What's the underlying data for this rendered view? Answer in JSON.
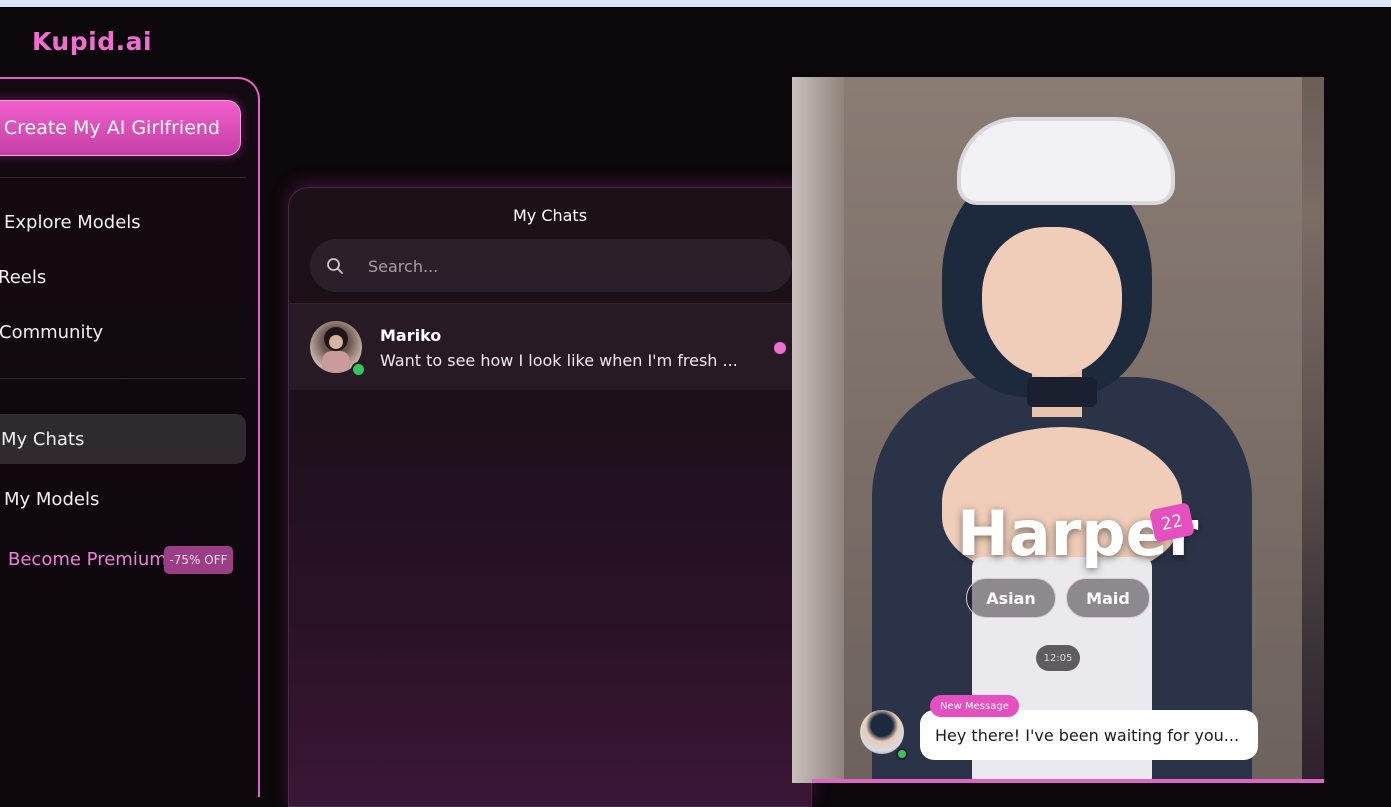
{
  "app": {
    "logo": "Kupid.ai"
  },
  "sidebar": {
    "create_button": "Create My AI Girlfriend",
    "items": [
      {
        "label": "Explore Models"
      },
      {
        "label": "Reels"
      },
      {
        "label": "Community"
      },
      {
        "label": "My Chats",
        "active": true
      },
      {
        "label": "My Models"
      }
    ],
    "premium": {
      "label": "Become Premium",
      "badge": "-75% OFF"
    }
  },
  "chats": {
    "title": "My Chats",
    "search_placeholder": "Search...",
    "list": [
      {
        "name": "Mariko",
        "preview": "Want to see how I look like when I'm fresh ...",
        "online": true,
        "unread": true
      }
    ]
  },
  "model": {
    "name": "Harper",
    "age": "22",
    "tags": [
      "Asian",
      "Maid"
    ],
    "timestamp": "12:05",
    "message_badge": "New Message",
    "message": "Hey there! I've been waiting for you..."
  },
  "colors": {
    "accent": "#e064c5",
    "background": "#0c070b",
    "online": "#37c45b"
  }
}
